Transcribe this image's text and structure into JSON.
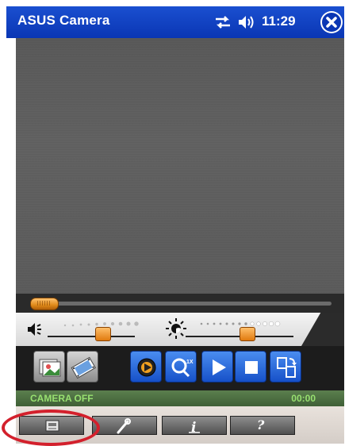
{
  "title_bar": {
    "app_title": "ASUS Camera",
    "time": "11:29",
    "icons": [
      "sync-icon",
      "volume-icon",
      "close-icon"
    ],
    "color": "#0a36b4"
  },
  "player": {
    "seek_progress": 0.05,
    "volume_level": 0.55,
    "brightness_level": 0.55
  },
  "toolbar": {
    "buttons": [
      {
        "name": "photo-album-button",
        "icon": "photo-album-icon"
      },
      {
        "name": "video-album-button",
        "icon": "video-album-icon"
      },
      {
        "name": "capture-button",
        "icon": "record-icon",
        "active": true
      },
      {
        "name": "zoom-button",
        "icon": "zoom-icon",
        "label": "1X"
      },
      {
        "name": "play-button",
        "icon": "play-icon"
      },
      {
        "name": "stop-button",
        "icon": "stop-icon"
      },
      {
        "name": "switch-mode-button",
        "icon": "switch-icon"
      }
    ]
  },
  "status": {
    "text": "CAMERA OFF",
    "time": "00:00"
  },
  "menu": {
    "buttons": [
      {
        "name": "menu-settings-button",
        "icon": "settings-icon",
        "highlighted": true
      },
      {
        "name": "menu-tools-button",
        "icon": "wrench-icon"
      },
      {
        "name": "menu-info-button",
        "icon": "info-icon"
      },
      {
        "name": "menu-help-button",
        "icon": "help-icon",
        "label": "?"
      }
    ],
    "highlight_color": "#d3202c"
  }
}
